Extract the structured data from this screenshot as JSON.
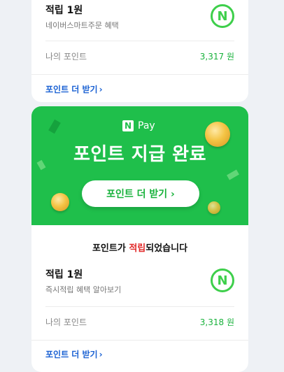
{
  "top_card": {
    "reward_title": "적립 1원",
    "reward_subtitle": "네이버스마트주문 혜택",
    "points_label": "나의 포인트",
    "points_value": "3,317 원",
    "cta_label": "포인트 더 받기"
  },
  "banner": {
    "logo_text": "Pay",
    "logo_badge": "N",
    "headline": "포인트 지급 완료",
    "button_label": "포인트 더 받기 ›"
  },
  "bottom_card": {
    "status_prefix": "포인트가 ",
    "status_highlight": "적립",
    "status_suffix": "되었습니다",
    "reward_title": "적립 1원",
    "reward_subtitle": "즉시적립 혜택 알아보기",
    "points_label": "나의 포인트",
    "points_value": "3,318 원",
    "cta_label": "포인트 더 받기"
  },
  "icons": {
    "npoint_icon": "N",
    "chevron": "›"
  },
  "colors": {
    "brand_green": "#1fbf4b",
    "link_blue": "#1a61d3",
    "highlight_red": "#e22a2a"
  }
}
